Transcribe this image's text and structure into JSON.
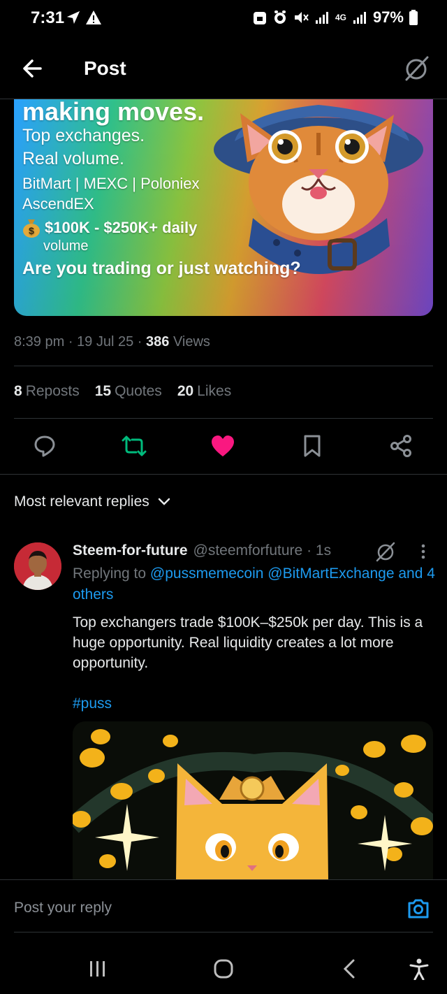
{
  "status_bar": {
    "time": "7:31",
    "network": "4G",
    "battery": "97%"
  },
  "header": {
    "title": "Post"
  },
  "banner": {
    "headline": "making moves.",
    "line1": "Top exchanges.",
    "line2": "Real volume.",
    "exchanges1": "BitMart | MEXC | Poloniex",
    "exchanges2": "AscendEX",
    "volume1": "$100K - $250K+ daily",
    "volume2": "volume",
    "question": "Are you trading or just watching?"
  },
  "meta": {
    "time": "8:39 pm",
    "date": "19 Jul 25",
    "views_count": "386",
    "views_label": "Views"
  },
  "stats": {
    "reposts_count": "8",
    "reposts_label": "Reposts",
    "quotes_count": "15",
    "quotes_label": "Quotes",
    "likes_count": "20",
    "likes_label": "Likes"
  },
  "colors": {
    "like": "#f91880",
    "repost": "#00ba7c",
    "link": "#1d9bf0",
    "muted": "#71767b"
  },
  "sort": {
    "label": "Most relevant replies"
  },
  "reply": {
    "name": "Steem-for-future",
    "handle": "@steemforfuture",
    "time": "1s",
    "replying_prefix": "Replying to",
    "mention1": "@pussmemecoin",
    "mention2": "@BitMartExchange",
    "others": "and 4 others",
    "body": "Top exchangers trade $100K–$250k per day. This is a huge opportunity. Real liquidity creates a lot more opportunity.",
    "hashtag": "#puss"
  },
  "reply_bar": {
    "placeholder": "Post your reply"
  }
}
